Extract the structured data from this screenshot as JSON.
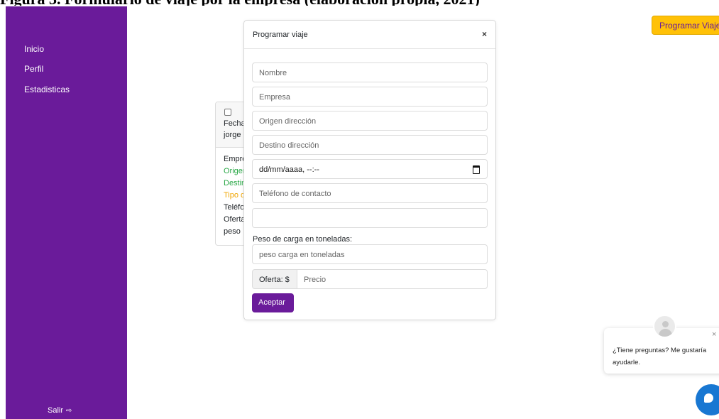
{
  "caption": "Figura 3. Formulario de viaje por la empresa (elaboración propia, 2021)",
  "colors": {
    "sidebar": "#6a1b9a",
    "accent_button": "#ffc107",
    "chat": "#1877d2"
  },
  "sidebar": {
    "items": [
      {
        "label": "Inicio"
      },
      {
        "label": "Perfil"
      },
      {
        "label": "Estadisticas"
      }
    ],
    "logout_label": "Salir",
    "logout_icon": "sign-out-icon"
  },
  "header": {
    "program_button": "Programar Viaje"
  },
  "card": {
    "header_lines": [
      "Fecha",
      "jorge"
    ],
    "body_lines": [
      {
        "text": "Empresa",
        "color": "#212529"
      },
      {
        "text": "Origen",
        "color": "#28a745"
      },
      {
        "text": "Destino",
        "color": "#28a745"
      },
      {
        "text": "Tipo de",
        "color": "#f0a500"
      },
      {
        "text": "Teléfono",
        "color": "#212529"
      },
      {
        "text": "Oferta",
        "color": "#212529"
      },
      {
        "text": "peso",
        "color": "#212529"
      }
    ]
  },
  "modal": {
    "title": "Programar viaje",
    "close": "×",
    "fields": {
      "nombre": "Nombre",
      "empresa": "Empresa",
      "origen": "Origen dirección",
      "destino": "Destino dirección",
      "fecha": "dd/mm/aaaa, --:--",
      "telefono": "Teléfono de contacto",
      "extra": "",
      "peso_label": "Peso de carga en toneladas:",
      "peso": "peso carga en toneladas",
      "oferta_prefix": "Oferta: $",
      "precio": "Precio"
    },
    "accept": "Aceptar"
  },
  "chat": {
    "message": "¿Tiene preguntas? Me gustaría ayudarle.",
    "close": "×"
  }
}
